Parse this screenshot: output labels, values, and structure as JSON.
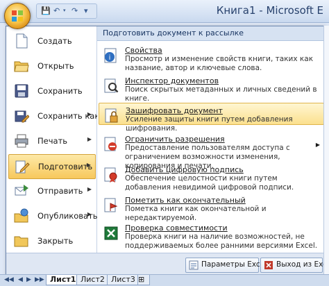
{
  "window": {
    "title": "Книга1 - Microsoft E"
  },
  "left_menu": [
    {
      "label": "Создать",
      "icon": "new-document-icon",
      "has_submenu": false
    },
    {
      "label": "Открыть",
      "icon": "open-folder-icon",
      "has_submenu": false
    },
    {
      "label": "Сохранить",
      "icon": "save-disk-icon",
      "has_submenu": false
    },
    {
      "label": "Сохранить как",
      "icon": "save-as-icon",
      "has_submenu": true
    },
    {
      "label": "Печать",
      "icon": "printer-icon",
      "has_submenu": true
    },
    {
      "label": "Подготовить",
      "icon": "prepare-pencil-icon",
      "has_submenu": true
    },
    {
      "label": "Отправить",
      "icon": "send-icon",
      "has_submenu": true
    },
    {
      "label": "Опубликовать",
      "icon": "publish-icon",
      "has_submenu": true
    },
    {
      "label": "Закрыть",
      "icon": "close-folder-icon",
      "has_submenu": false
    }
  ],
  "submenu": {
    "header": "Подготовить документ к рассылке",
    "items": [
      {
        "title": "Свойства",
        "desc": "Просмотр и изменение свойств книги, таких как название, автор и ключевые слова.",
        "icon": "properties-icon"
      },
      {
        "title": "Инспектор документов",
        "desc": "Поиск скрытых метаданных и личных сведений в книге.",
        "icon": "inspect-document-icon"
      },
      {
        "title": "Зашифровать документ",
        "desc": "Усиление защиты книги путем добавления шифрования.",
        "icon": "encrypt-lock-icon"
      },
      {
        "title": "Ограничить разрешения",
        "desc": "Предоставление пользователям доступа с ограничением возможности изменения, копирования и печати.",
        "icon": "restrict-permission-icon"
      },
      {
        "title": "Добавить цифровую подпись",
        "desc": "Обеспечение целостности книги путем добавления невидимой цифровой подписи.",
        "icon": "digital-signature-icon"
      },
      {
        "title": "Пометить как окончательный",
        "desc": "Пометка книги как окончательной и нередактируемой.",
        "icon": "mark-final-icon"
      },
      {
        "title": "Проверка совместимости",
        "desc": "Проверка книги на наличие возможностей, не поддерживаемых более ранними версиями Excel.",
        "icon": "compatibility-check-icon"
      }
    ]
  },
  "bottom_buttons": {
    "options": "Параметры Excel",
    "exit": "Выход из Excel"
  },
  "sheets": [
    "Лист1",
    "Лист2",
    "Лист3"
  ],
  "colors": {
    "accent_orange": "#f7c85c",
    "frame_blue": "#6b86b0",
    "header_blue": "#d6e2f2"
  }
}
